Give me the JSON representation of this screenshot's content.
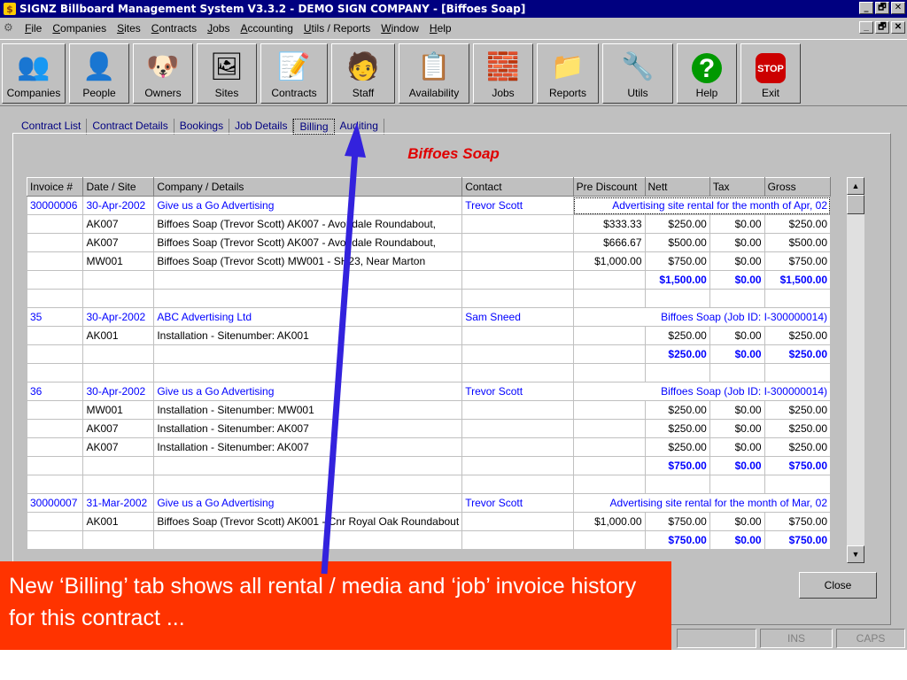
{
  "window": {
    "title": "SIGNZ Billboard Management System V3.3.2 - DEMO SIGN COMPANY - [Biffoes Soap]",
    "min": "_",
    "max": "🗗",
    "close": "✕"
  },
  "menu": [
    "File",
    "Companies",
    "Sites",
    "Contracts",
    "Jobs",
    "Accounting",
    "Utils / Reports",
    "Window",
    "Help"
  ],
  "toolbar": [
    {
      "label": "Companies",
      "icon": "👥"
    },
    {
      "label": "People",
      "icon": "👤"
    },
    {
      "label": "Owners",
      "icon": "🐶"
    },
    {
      "label": "Sites",
      "icon": "🖼"
    },
    {
      "label": "Contracts",
      "icon": "📝"
    },
    {
      "label": "Staff",
      "icon": "🧑"
    },
    {
      "label": "Availability",
      "icon": "📋"
    },
    {
      "label": "Jobs",
      "icon": "🧱"
    },
    {
      "label": "Reports",
      "icon": "📁"
    },
    {
      "label": "Utils",
      "icon": "🔧"
    },
    {
      "label": "Help",
      "icon": "?"
    },
    {
      "label": "Exit",
      "icon": "STOP"
    }
  ],
  "tabs": [
    "Contract List",
    "Contract Details",
    "Bookings",
    "Job Details",
    "Billing",
    "Auditing"
  ],
  "active_tab": "Billing",
  "contract_title": "Biffoes Soap",
  "columns": [
    "Invoice #",
    "Date / Site",
    "Company / Details",
    "Contact",
    "Pre Discount",
    "Nett",
    "Tax",
    "Gross"
  ],
  "rows": [
    {
      "kind": "header",
      "inv": "30000006",
      "date": "30-Apr-2002",
      "company": "Give us a Go Advertising",
      "contact": "Trevor Scott",
      "note": "Advertising site rental for the month of Apr, 02"
    },
    {
      "kind": "line",
      "date": "AK007",
      "company": "Biffoes Soap (Trevor Scott) AK007 - Avondale Roundabout,",
      "pre": "$333.33",
      "nett": "$250.00",
      "tax": "$0.00",
      "gross": "$250.00"
    },
    {
      "kind": "line",
      "date": "AK007",
      "company": "Biffoes Soap (Trevor Scott) AK007 - Avondale Roundabout,",
      "pre": "$666.67",
      "nett": "$500.00",
      "tax": "$0.00",
      "gross": "$500.00"
    },
    {
      "kind": "line",
      "date": "MW001",
      "company": "Biffoes Soap (Trevor Scott) MW001 - SH23, Near Marton",
      "pre": "$1,000.00",
      "nett": "$750.00",
      "tax": "$0.00",
      "gross": "$750.00"
    },
    {
      "kind": "total",
      "nett": "$1,500.00",
      "tax": "$0.00",
      "gross": "$1,500.00"
    },
    {
      "kind": "blank"
    },
    {
      "kind": "header",
      "inv": "35",
      "date": "30-Apr-2002",
      "company": "ABC Advertising Ltd",
      "contact": "Sam Sneed",
      "note": "Biffoes Soap (Job ID: I-300000014)"
    },
    {
      "kind": "line",
      "date": "AK001",
      "company": "Installation - Sitenumber: AK001",
      "pre": "",
      "nett": "$250.00",
      "tax": "$0.00",
      "gross": "$250.00"
    },
    {
      "kind": "total",
      "nett": "$250.00",
      "tax": "$0.00",
      "gross": "$250.00"
    },
    {
      "kind": "blank"
    },
    {
      "kind": "header",
      "inv": "36",
      "date": "30-Apr-2002",
      "company": "Give us a Go Advertising",
      "contact": "Trevor Scott",
      "note": "Biffoes Soap (Job ID: I-300000014)"
    },
    {
      "kind": "line",
      "date": "MW001",
      "company": "Installation - Sitenumber: MW001",
      "pre": "",
      "nett": "$250.00",
      "tax": "$0.00",
      "gross": "$250.00"
    },
    {
      "kind": "line",
      "date": "AK007",
      "company": "Installation - Sitenumber: AK007",
      "pre": "",
      "nett": "$250.00",
      "tax": "$0.00",
      "gross": "$250.00"
    },
    {
      "kind": "line",
      "date": "AK007",
      "company": "Installation - Sitenumber: AK007",
      "pre": "",
      "nett": "$250.00",
      "tax": "$0.00",
      "gross": "$250.00"
    },
    {
      "kind": "total",
      "nett": "$750.00",
      "tax": "$0.00",
      "gross": "$750.00"
    },
    {
      "kind": "blank"
    },
    {
      "kind": "header",
      "inv": "30000007",
      "date": "31-Mar-2002",
      "company": "Give us a Go Advertising",
      "contact": "Trevor Scott",
      "note": "Advertising site rental for the month of Mar, 02"
    },
    {
      "kind": "line",
      "date": "AK001",
      "company": "Biffoes Soap (Trevor Scott) AK001 - Cnr Royal Oak Roundabout",
      "pre": "$1,000.00",
      "nett": "$750.00",
      "tax": "$0.00",
      "gross": "$750.00"
    },
    {
      "kind": "total",
      "nett": "$750.00",
      "tax": "$0.00",
      "gross": "$750.00"
    }
  ],
  "close_label": "Close",
  "status": {
    "ins": "INS",
    "caps": "CAPS"
  },
  "callout": "New ‘Billing’ tab shows all rental / media and ‘job’ invoice history for this contract ...",
  "colors": {
    "accent": "#000080",
    "title_red": "#e00000",
    "callout": "#ff3300",
    "link_blue": "#0000ff"
  }
}
